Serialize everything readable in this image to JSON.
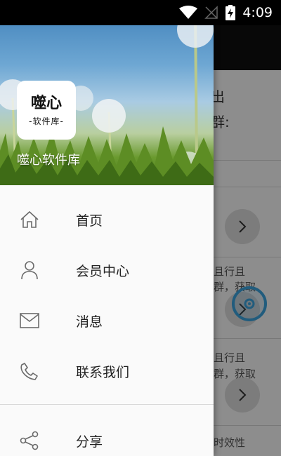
{
  "status_bar": {
    "time": "4:09",
    "icons": [
      "wifi-icon",
      "no-signal-icon",
      "battery-charging-icon"
    ]
  },
  "drawer": {
    "header": {
      "logo_title": "噬心",
      "logo_subtitle": "-软件库-",
      "app_name": "噬心软件库"
    },
    "menu": [
      {
        "label": "首页",
        "icon": "home-icon"
      },
      {
        "label": "会员中心",
        "icon": "user-icon"
      },
      {
        "label": "消息",
        "icon": "mail-icon"
      },
      {
        "label": "联系我们",
        "icon": "phone-icon"
      }
    ],
    "share": {
      "label": "分享",
      "icon": "share-icon"
    }
  },
  "background": {
    "line1": "出",
    "line2": "群:",
    "row1a": "且行且",
    "row1b": "群，获取",
    "row2a": "且行且",
    "row2b": "群，获取",
    "row3": "时效性"
  }
}
